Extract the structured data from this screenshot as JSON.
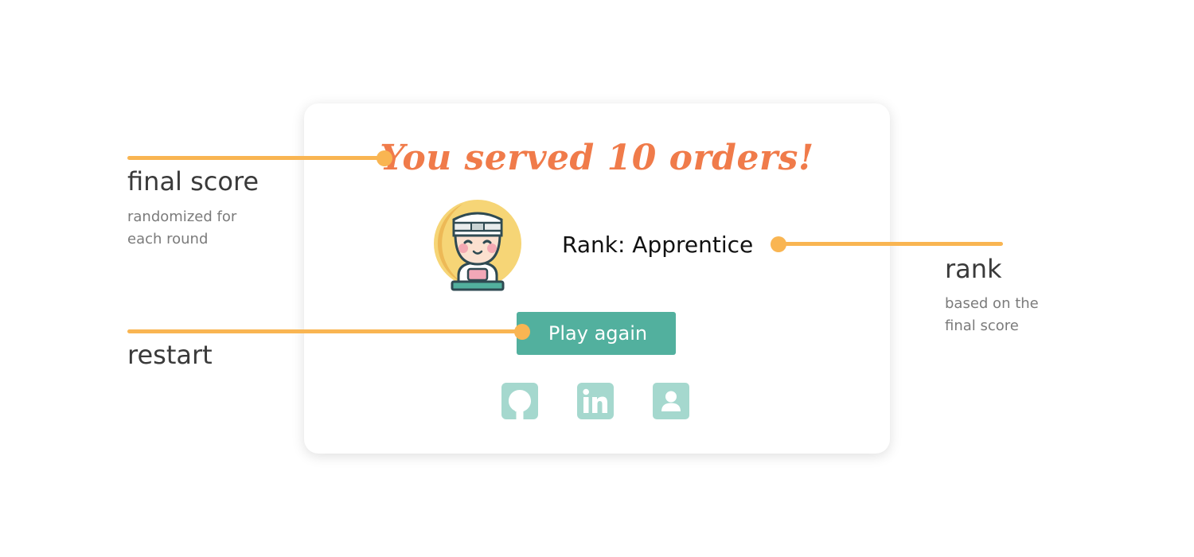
{
  "result": {
    "headline": "You served 10 orders!",
    "rank_text": "Rank: Apprentice",
    "play_again_label": "Play again"
  },
  "social": [
    {
      "name": "github-icon"
    },
    {
      "name": "linkedin-icon"
    },
    {
      "name": "person-icon"
    }
  ],
  "annotations": {
    "final_score": {
      "title": "final score",
      "desc": "randomized for each round"
    },
    "rank": {
      "title": "rank",
      "desc": "based on the final score"
    },
    "restart": {
      "title": "restart"
    }
  },
  "colors": {
    "accent_orange": "#F07B4A",
    "annotation_line": "#F9B552",
    "button_teal": "#52B09E",
    "icon_teal": "#A5D8CE"
  }
}
